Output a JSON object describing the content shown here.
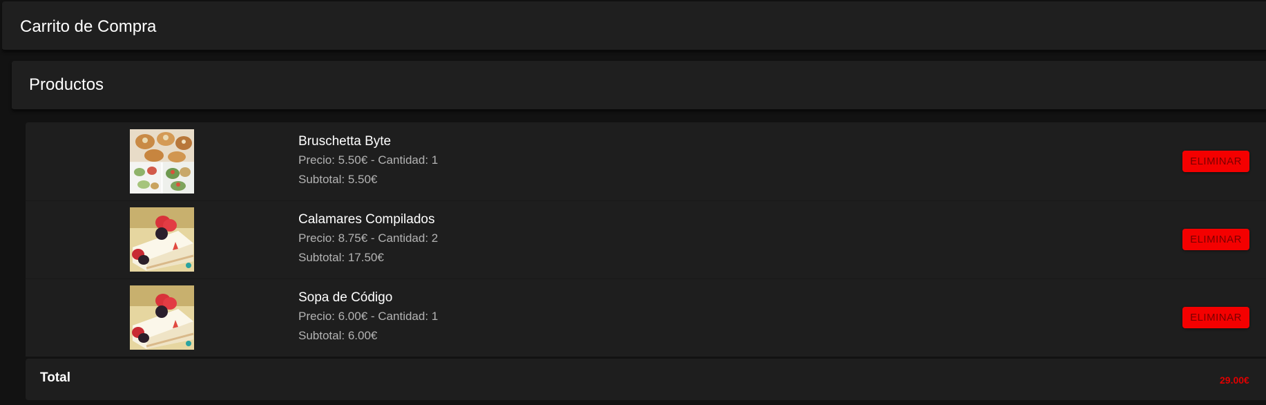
{
  "header": {
    "title": "Carrito de Compra"
  },
  "card": {
    "title": "Productos"
  },
  "items": [
    {
      "name": "Bruschetta Byte",
      "price_line": "Precio: 5.50€ - Cantidad: 1",
      "subtotal_line": "Subtotal: 5.50€",
      "remove_label": "ELIMINAR",
      "image": "bruschetta-photo"
    },
    {
      "name": "Calamares Compilados",
      "price_line": "Precio: 8.75€ - Cantidad: 2",
      "subtotal_line": "Subtotal: 17.50€",
      "remove_label": "ELIMINAR",
      "image": "cheesecake-photo"
    },
    {
      "name": "Sopa de Código",
      "price_line": "Precio: 6.00€ - Cantidad: 1",
      "subtotal_line": "Subtotal: 6.00€",
      "remove_label": "ELIMINAR",
      "image": "cheesecake-photo"
    }
  ],
  "total": {
    "label": "Total",
    "value": "29.00€"
  },
  "colors": {
    "background": "#121212",
    "surface": "#1f1f1f",
    "danger": "#f40000",
    "total_value": "#e00000"
  }
}
